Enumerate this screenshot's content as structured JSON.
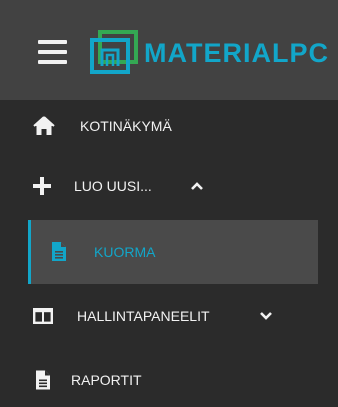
{
  "header": {
    "logo_text": "MATERIALPC",
    "brand_color": "#12a6c9",
    "menu_icon": "hamburger-icon"
  },
  "menu": {
    "home": {
      "label": "KOTINÄKYMÄ",
      "icon": "home-icon"
    },
    "create_new": {
      "label": "LUO UUSI...",
      "icon": "plus-icon",
      "expanded": true,
      "chevron": "chevron-up-icon"
    },
    "load": {
      "label": "KUORMA",
      "icon": "file-icon",
      "active": true
    },
    "dashboards": {
      "label": "HALLINTAPANEELIT",
      "icon": "panel-icon",
      "expanded": false,
      "chevron": "chevron-down-icon"
    },
    "reports": {
      "label": "RAPORTIT",
      "icon": "file-icon"
    }
  }
}
